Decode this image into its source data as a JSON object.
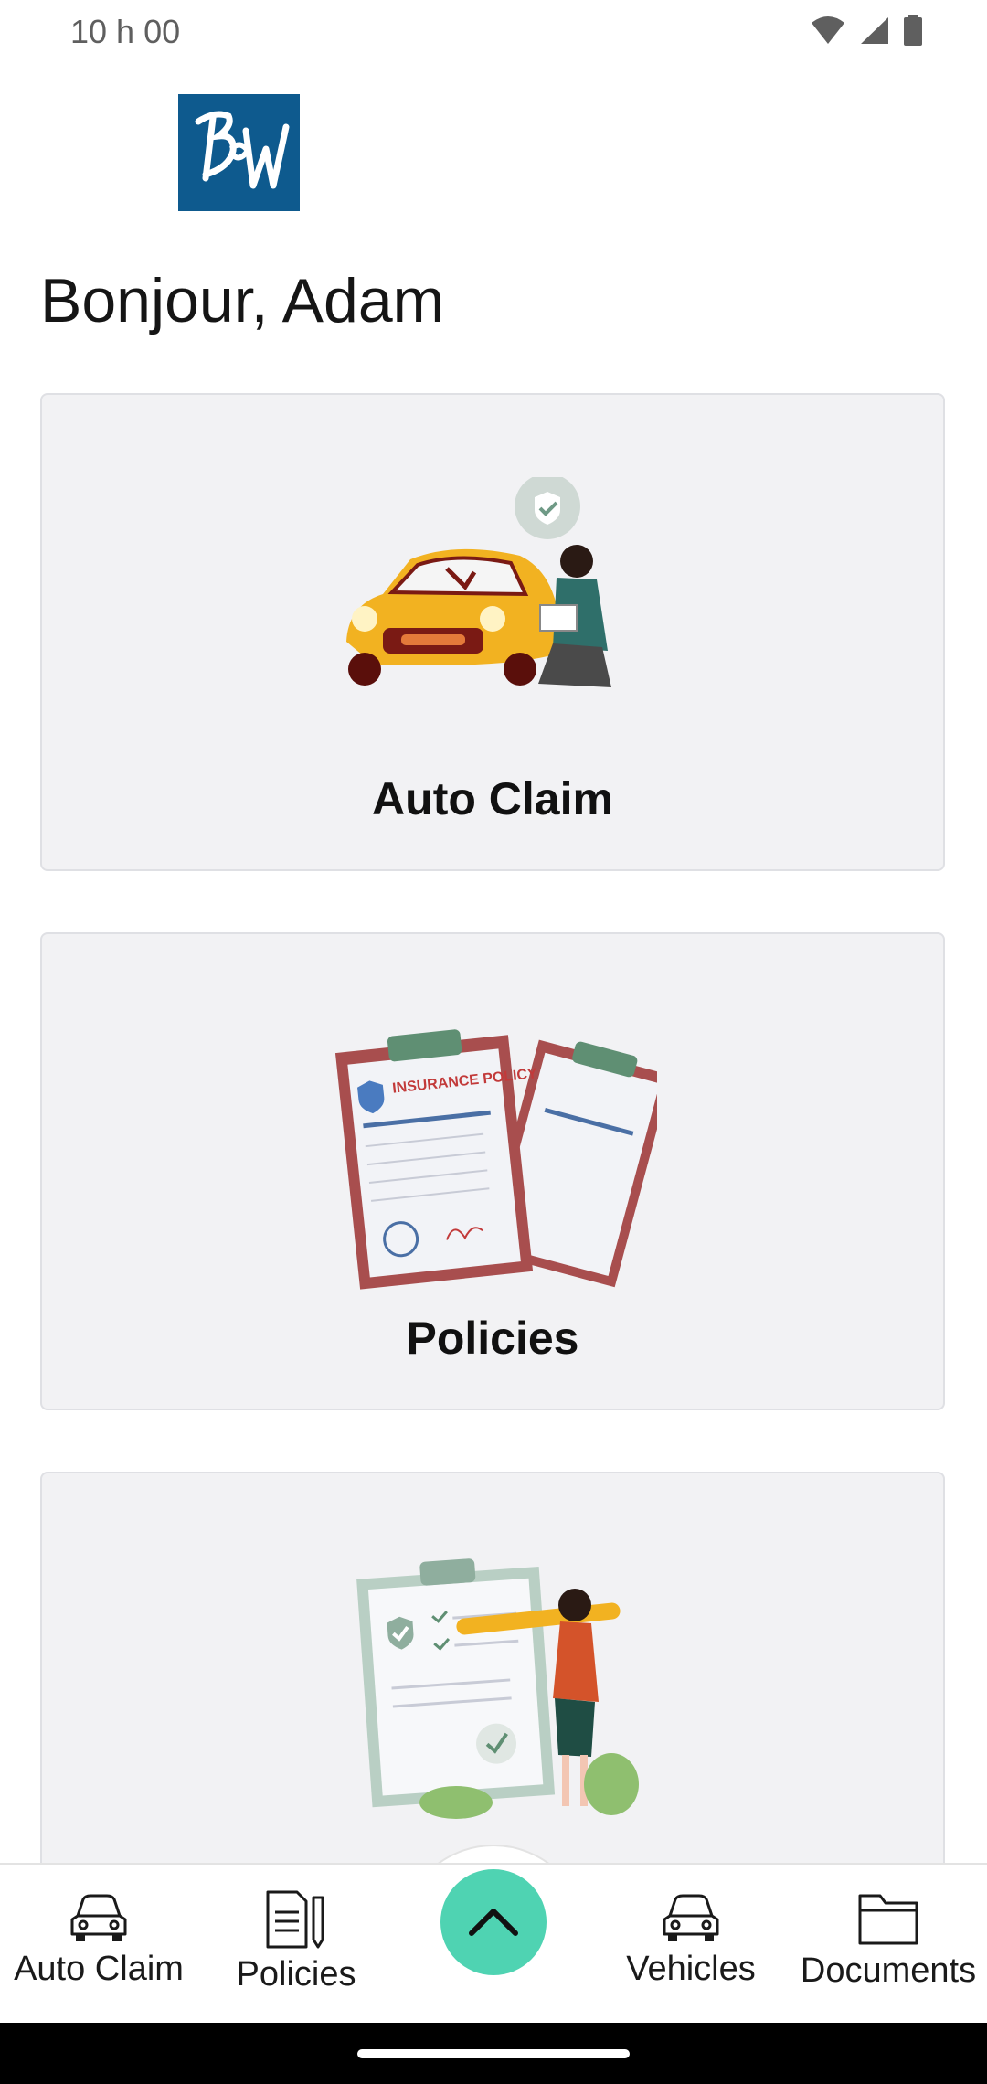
{
  "status": {
    "time": "10 h 00"
  },
  "greeting": "Bonjour, Adam",
  "cards": [
    {
      "label": "Auto Claim",
      "icon": "car-damage-illustration"
    },
    {
      "label": "Policies",
      "icon": "insurance-policy-illustration",
      "illustration_text": "INSURANCE POLICY"
    },
    {
      "label": "",
      "icon": "checklist-illustration"
    }
  ],
  "bottom_nav": {
    "items": [
      {
        "label": "Auto Claim",
        "icon": "car-icon"
      },
      {
        "label": "Policies",
        "icon": "document-pen-icon"
      },
      {
        "label": "Vehicles",
        "icon": "car-icon"
      },
      {
        "label": "Documents",
        "icon": "folder-icon"
      }
    ],
    "fab_icon": "chevron-up-icon"
  },
  "colors": {
    "brand_blue": "#0e5a8e",
    "fab_teal": "#4fd3b2",
    "card_bg": "#f2f2f4"
  }
}
